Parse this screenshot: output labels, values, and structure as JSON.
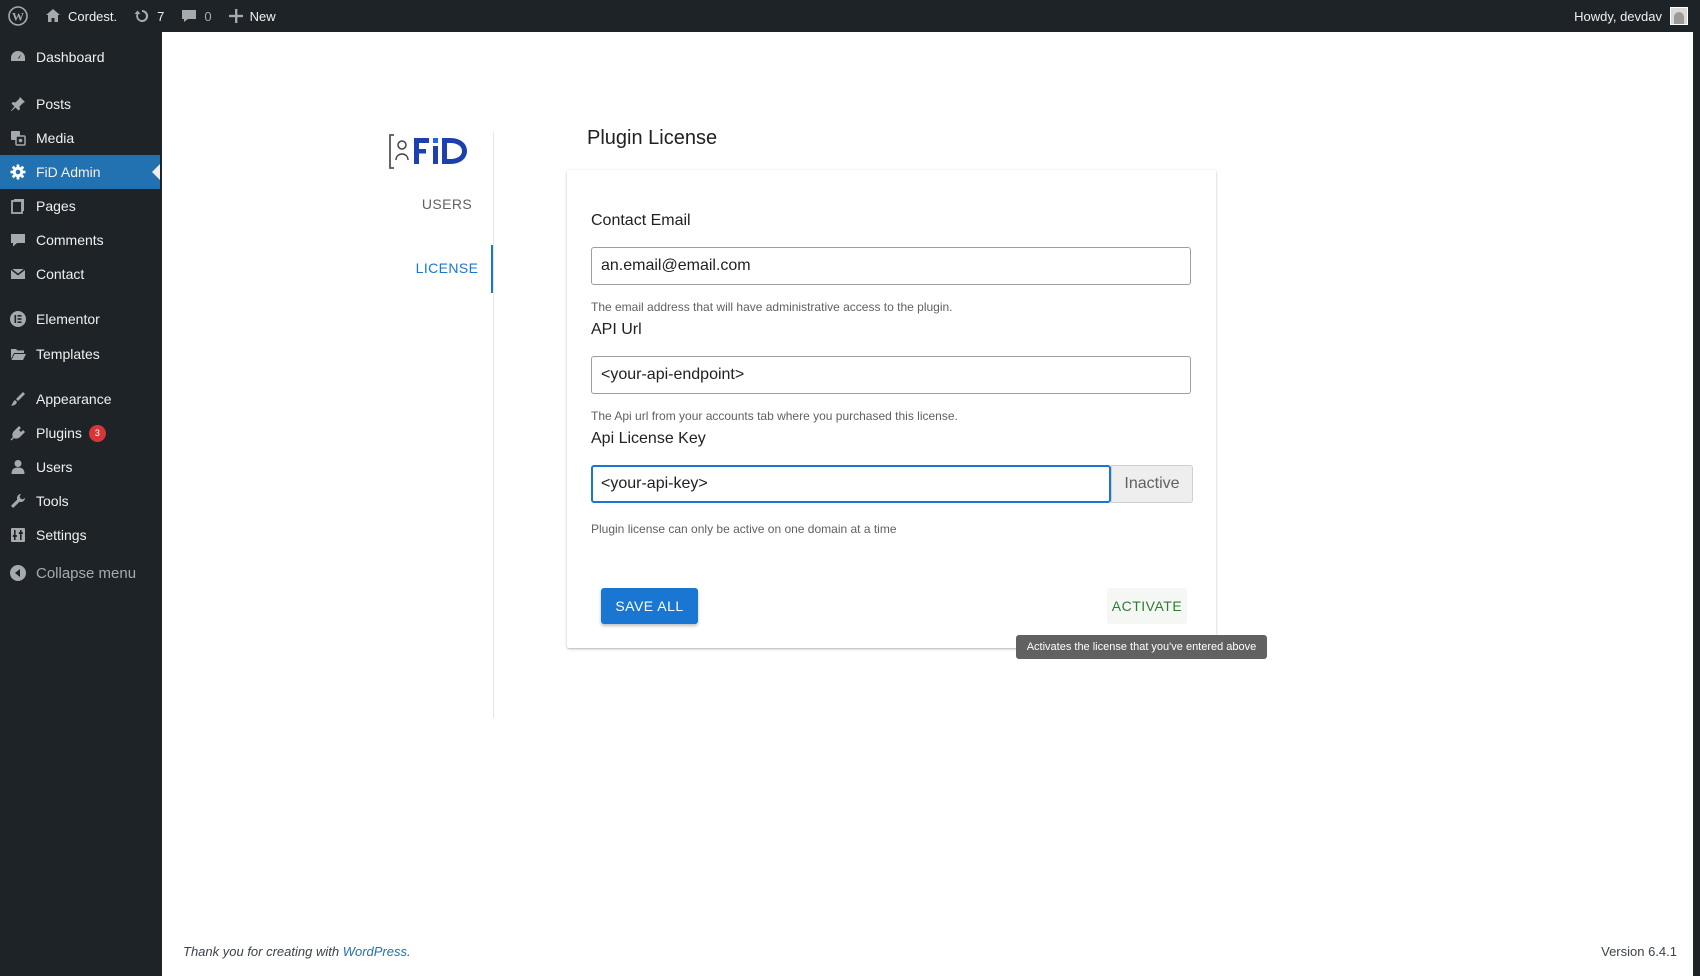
{
  "admin_bar": {
    "site_name": "Cordest.",
    "updates_count": "7",
    "comments_count": "0",
    "new_label": "New",
    "greeting": "Howdy, devdav"
  },
  "sidebar": {
    "items": [
      {
        "label": "Dashboard",
        "icon": "dashboard-icon"
      },
      {
        "label": "Posts",
        "icon": "pin-icon"
      },
      {
        "label": "Media",
        "icon": "media-icon"
      },
      {
        "label": "FiD Admin",
        "icon": "gear-icon",
        "current": true
      },
      {
        "label": "Pages",
        "icon": "pages-icon"
      },
      {
        "label": "Comments",
        "icon": "comment-icon"
      },
      {
        "label": "Contact",
        "icon": "mail-icon"
      },
      {
        "label": "Elementor",
        "icon": "elementor-icon"
      },
      {
        "label": "Templates",
        "icon": "folder-icon"
      },
      {
        "label": "Appearance",
        "icon": "brush-icon"
      },
      {
        "label": "Plugins",
        "icon": "plugin-icon",
        "badge": "3"
      },
      {
        "label": "Users",
        "icon": "user-icon"
      },
      {
        "label": "Tools",
        "icon": "wrench-icon"
      },
      {
        "label": "Settings",
        "icon": "settings-icon"
      }
    ],
    "collapse_label": "Collapse menu"
  },
  "plugin_nav": {
    "logo_text": "FiD",
    "tabs": [
      {
        "label": "USERS",
        "active": false
      },
      {
        "label": "LICENSE",
        "active": true
      }
    ]
  },
  "license": {
    "page_title": "Plugin License",
    "contact_email": {
      "label": "Contact Email",
      "value": "an.email@email.com",
      "help": "The email address that will have administrative access to the plugin."
    },
    "api_url": {
      "label": "API Url",
      "value": "<your-api-endpoint>",
      "help": "The Api url from your accounts tab where you purchased this license."
    },
    "api_key": {
      "label": "Api License Key",
      "value": "<your-api-key>",
      "status": "Inactive",
      "help": "Plugin license can only be active on one domain at a time"
    },
    "save_button": "SAVE ALL",
    "activate_button": "ACTIVATE",
    "activate_tooltip": "Activates the license that you've entered above"
  },
  "footer": {
    "thanks_prefix": "Thank you for creating with ",
    "thanks_link": "WordPress",
    "thanks_suffix": ".",
    "version": "Version 6.4.1"
  },
  "colors": {
    "admin_dark": "#1d2327",
    "wp_blue": "#2271b1",
    "primary": "#1976d2",
    "success": "#2e7d32",
    "badge_red": "#d63638"
  }
}
